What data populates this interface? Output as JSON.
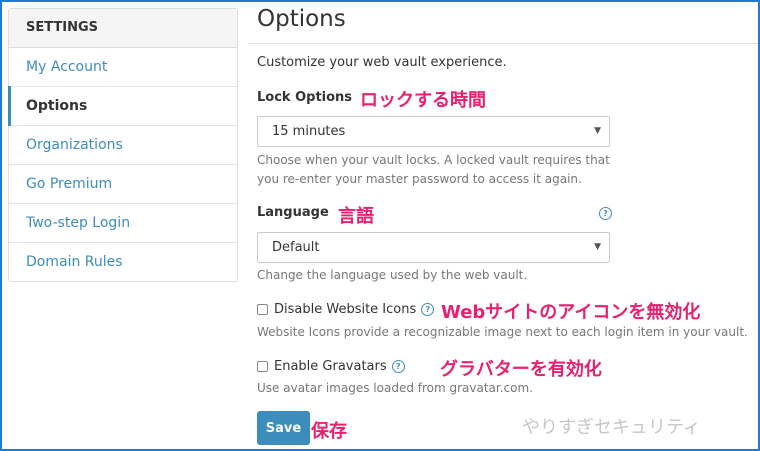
{
  "sidebar": {
    "header": "SETTINGS",
    "items": [
      {
        "label": "My Account"
      },
      {
        "label": "Options"
      },
      {
        "label": "Organizations"
      },
      {
        "label": "Go Premium"
      },
      {
        "label": "Two-step Login"
      },
      {
        "label": "Domain Rules"
      }
    ]
  },
  "main": {
    "title": "Options",
    "description": "Customize your web vault experience.",
    "lock": {
      "label": "Lock Options",
      "annotation": "ロックする時間",
      "value": "15 minutes",
      "help1": "Choose when your vault locks. A locked vault requires that",
      "help2": "you re-enter your master password to access it again."
    },
    "language": {
      "label": "Language",
      "annotation": "言語",
      "value": "Default",
      "help": "Change the language used by the web vault."
    },
    "website_icons": {
      "label": "Disable Website Icons",
      "annotation": "Webサイトのアイコンを無効化",
      "help": "Website Icons provide a recognizable image next to each login item in your vault."
    },
    "gravatars": {
      "label": "Enable Gravatars",
      "annotation": "グラバターを有効化",
      "help": "Use avatar images loaded from gravatar.com."
    },
    "save": {
      "label": "Save",
      "annotation": "保存"
    }
  },
  "watermark": "やりすぎセキュリティ",
  "colors": {
    "accent": "#3c8dbc",
    "annotation": "#e8206f",
    "frame": "#1e7ad6"
  }
}
